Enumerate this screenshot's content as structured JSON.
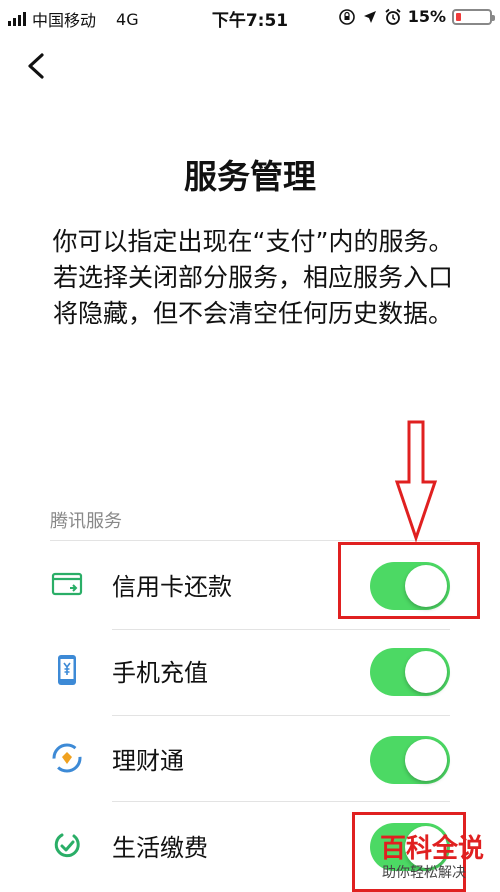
{
  "status_bar": {
    "carrier": "中国移动",
    "network": "4G",
    "time": "下午7:51",
    "battery_percent": "15%",
    "battery_level": 0.15
  },
  "header": {
    "back_icon": "chevron-left-icon"
  },
  "page": {
    "title": "服务管理",
    "description": "你可以指定出现在“支付”内的服务。若选择关闭部分服务，相应服务入口将隐藏，但不会清空任何历史数据。"
  },
  "section": {
    "title": "腾讯服务",
    "items": [
      {
        "label": "信用卡还款",
        "icon": "credit-card-icon",
        "enabled": true
      },
      {
        "label": "手机充值",
        "icon": "phone-recharge-icon",
        "enabled": true
      },
      {
        "label": "理财通",
        "icon": "wealth-icon",
        "enabled": true
      },
      {
        "label": "生活缴费",
        "icon": "utility-bill-icon",
        "enabled": true
      }
    ]
  },
  "watermark": {
    "title": "百科全说",
    "subtitle": "助你轻松解决"
  },
  "colors": {
    "toggle_on": "#4cd964",
    "annotation_red": "#e02020",
    "icon_green": "#2aae67",
    "icon_blue": "#3d8ad6",
    "icon_orange": "#f0a11f"
  }
}
